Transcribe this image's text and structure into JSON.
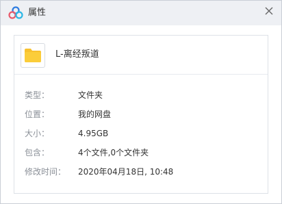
{
  "window": {
    "title": "属性",
    "title_icon": "baidu-netdisk-logo-icon",
    "close_icon": "close-icon"
  },
  "file": {
    "name": "L-离经叛道",
    "icon": "folder-icon",
    "folder_color": "#f8c12e"
  },
  "properties": [
    {
      "label": "类型：",
      "value": "文件夹"
    },
    {
      "label": "位置：",
      "value": "我的网盘"
    },
    {
      "label": "大小：",
      "value": "4.95GB"
    },
    {
      "label": "包含：",
      "value": "4个文件,0个文件夹"
    },
    {
      "label": "修改时间：",
      "value": "2020年04月18日, 10:48"
    }
  ]
}
